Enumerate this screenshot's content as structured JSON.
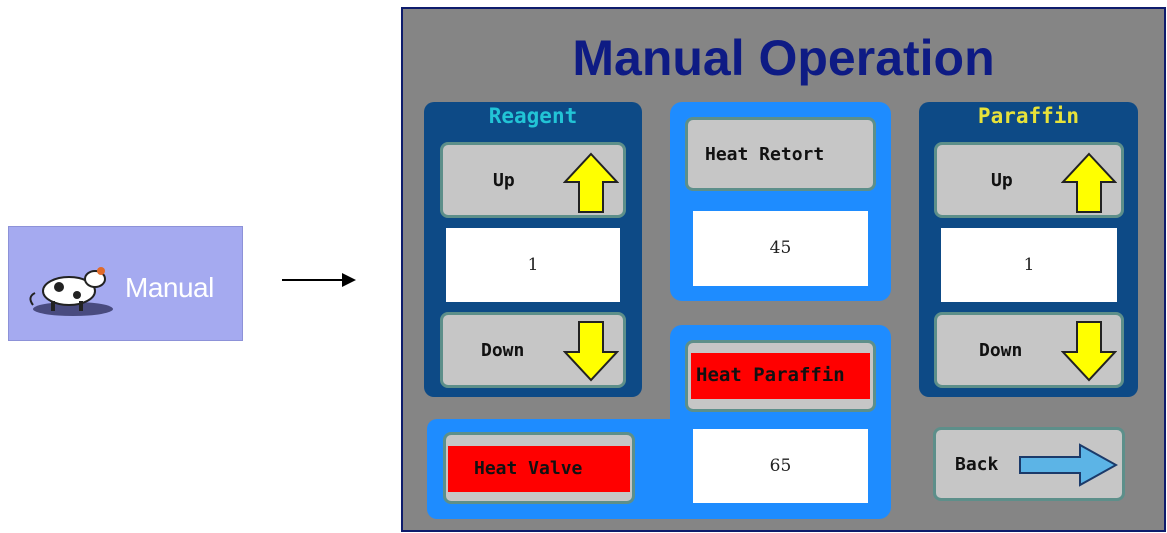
{
  "launcher": {
    "label": "Manual",
    "icon": "cow-logo-icon",
    "bg_color": "#a5aaf0"
  },
  "panel": {
    "title": "Manual Operation",
    "bg_color": "#858585",
    "title_color": "#0e1b84"
  },
  "reagent": {
    "title": "Reagent",
    "title_color": "#22c4d6",
    "up_label": "Up",
    "down_label": "Down",
    "value": "1"
  },
  "paraffin": {
    "title": "Paraffin",
    "title_color": "#e7e23a",
    "up_label": "Up",
    "down_label": "Down",
    "value": "1"
  },
  "retort": {
    "label": "Heat Retort",
    "value": "45"
  },
  "heat_paraffin": {
    "label": "Heat Paraffin",
    "value": "65",
    "active_color": "#ff0000"
  },
  "heat_valve": {
    "label": "Heat Valve",
    "active_color": "#ff0000"
  },
  "back": {
    "label": "Back",
    "icon": "arrow-right-icon"
  },
  "icons": {
    "up": "arrow-up-icon",
    "down": "arrow-down-icon",
    "arrow_color": "#ffff00"
  }
}
